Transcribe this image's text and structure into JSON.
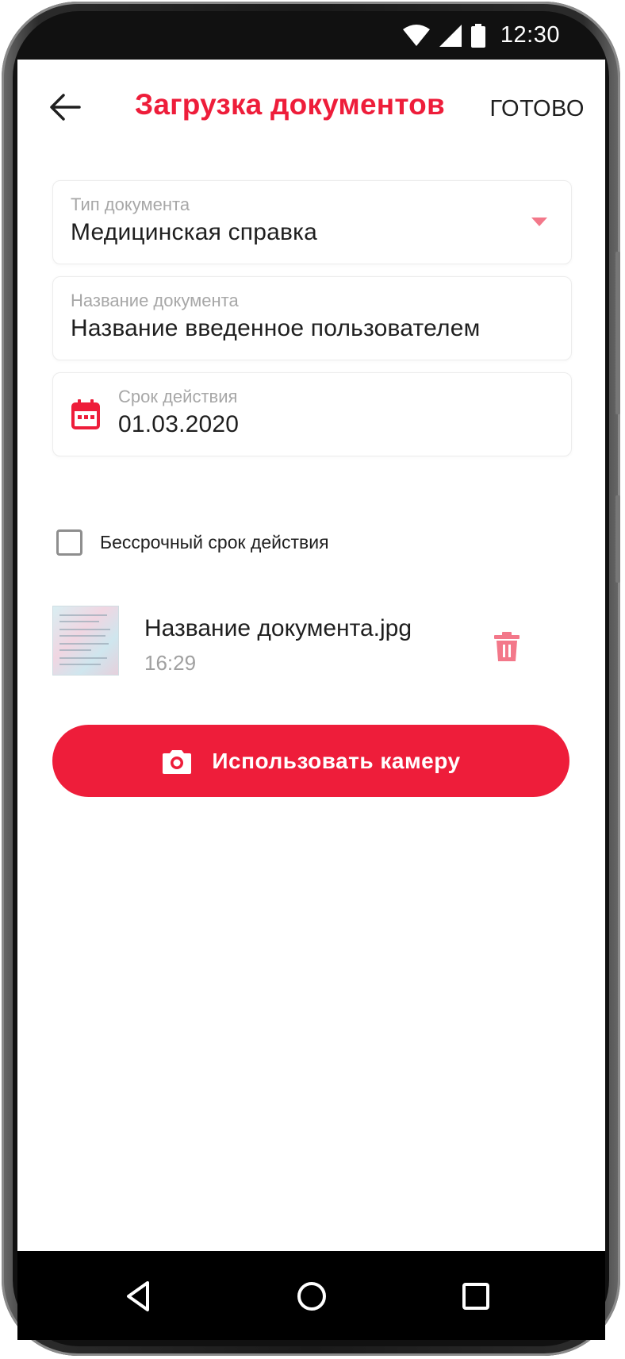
{
  "status_bar": {
    "time": "12:30"
  },
  "header": {
    "title": "Загрузка документов",
    "done_label": "ГОТОВО"
  },
  "form": {
    "doc_type": {
      "label": "Тип документа",
      "value": "Медицинская справка"
    },
    "doc_name": {
      "label": "Название документа",
      "value": "Название введенное пользователем"
    },
    "validity": {
      "label": "Срок действия",
      "value": "01.03.2020"
    },
    "indefinite": {
      "label": "Бессрочный срок действия",
      "checked": false
    }
  },
  "attachment": {
    "file_name": "Название документа.jpg",
    "time": "16:29"
  },
  "camera_button": {
    "label": "Использовать камеру"
  },
  "colors": {
    "accent": "#ee1d3a",
    "accent_light": "#f3788a",
    "text": "#1f1f1f",
    "hint": "#a7a7a7"
  },
  "icons": [
    "back-arrow-icon",
    "dropdown-arrow-icon",
    "calendar-icon",
    "trash-icon",
    "camera-icon",
    "wifi-icon",
    "signal-icon",
    "battery-icon",
    "nav-back-icon",
    "nav-home-icon",
    "nav-recents-icon"
  ]
}
